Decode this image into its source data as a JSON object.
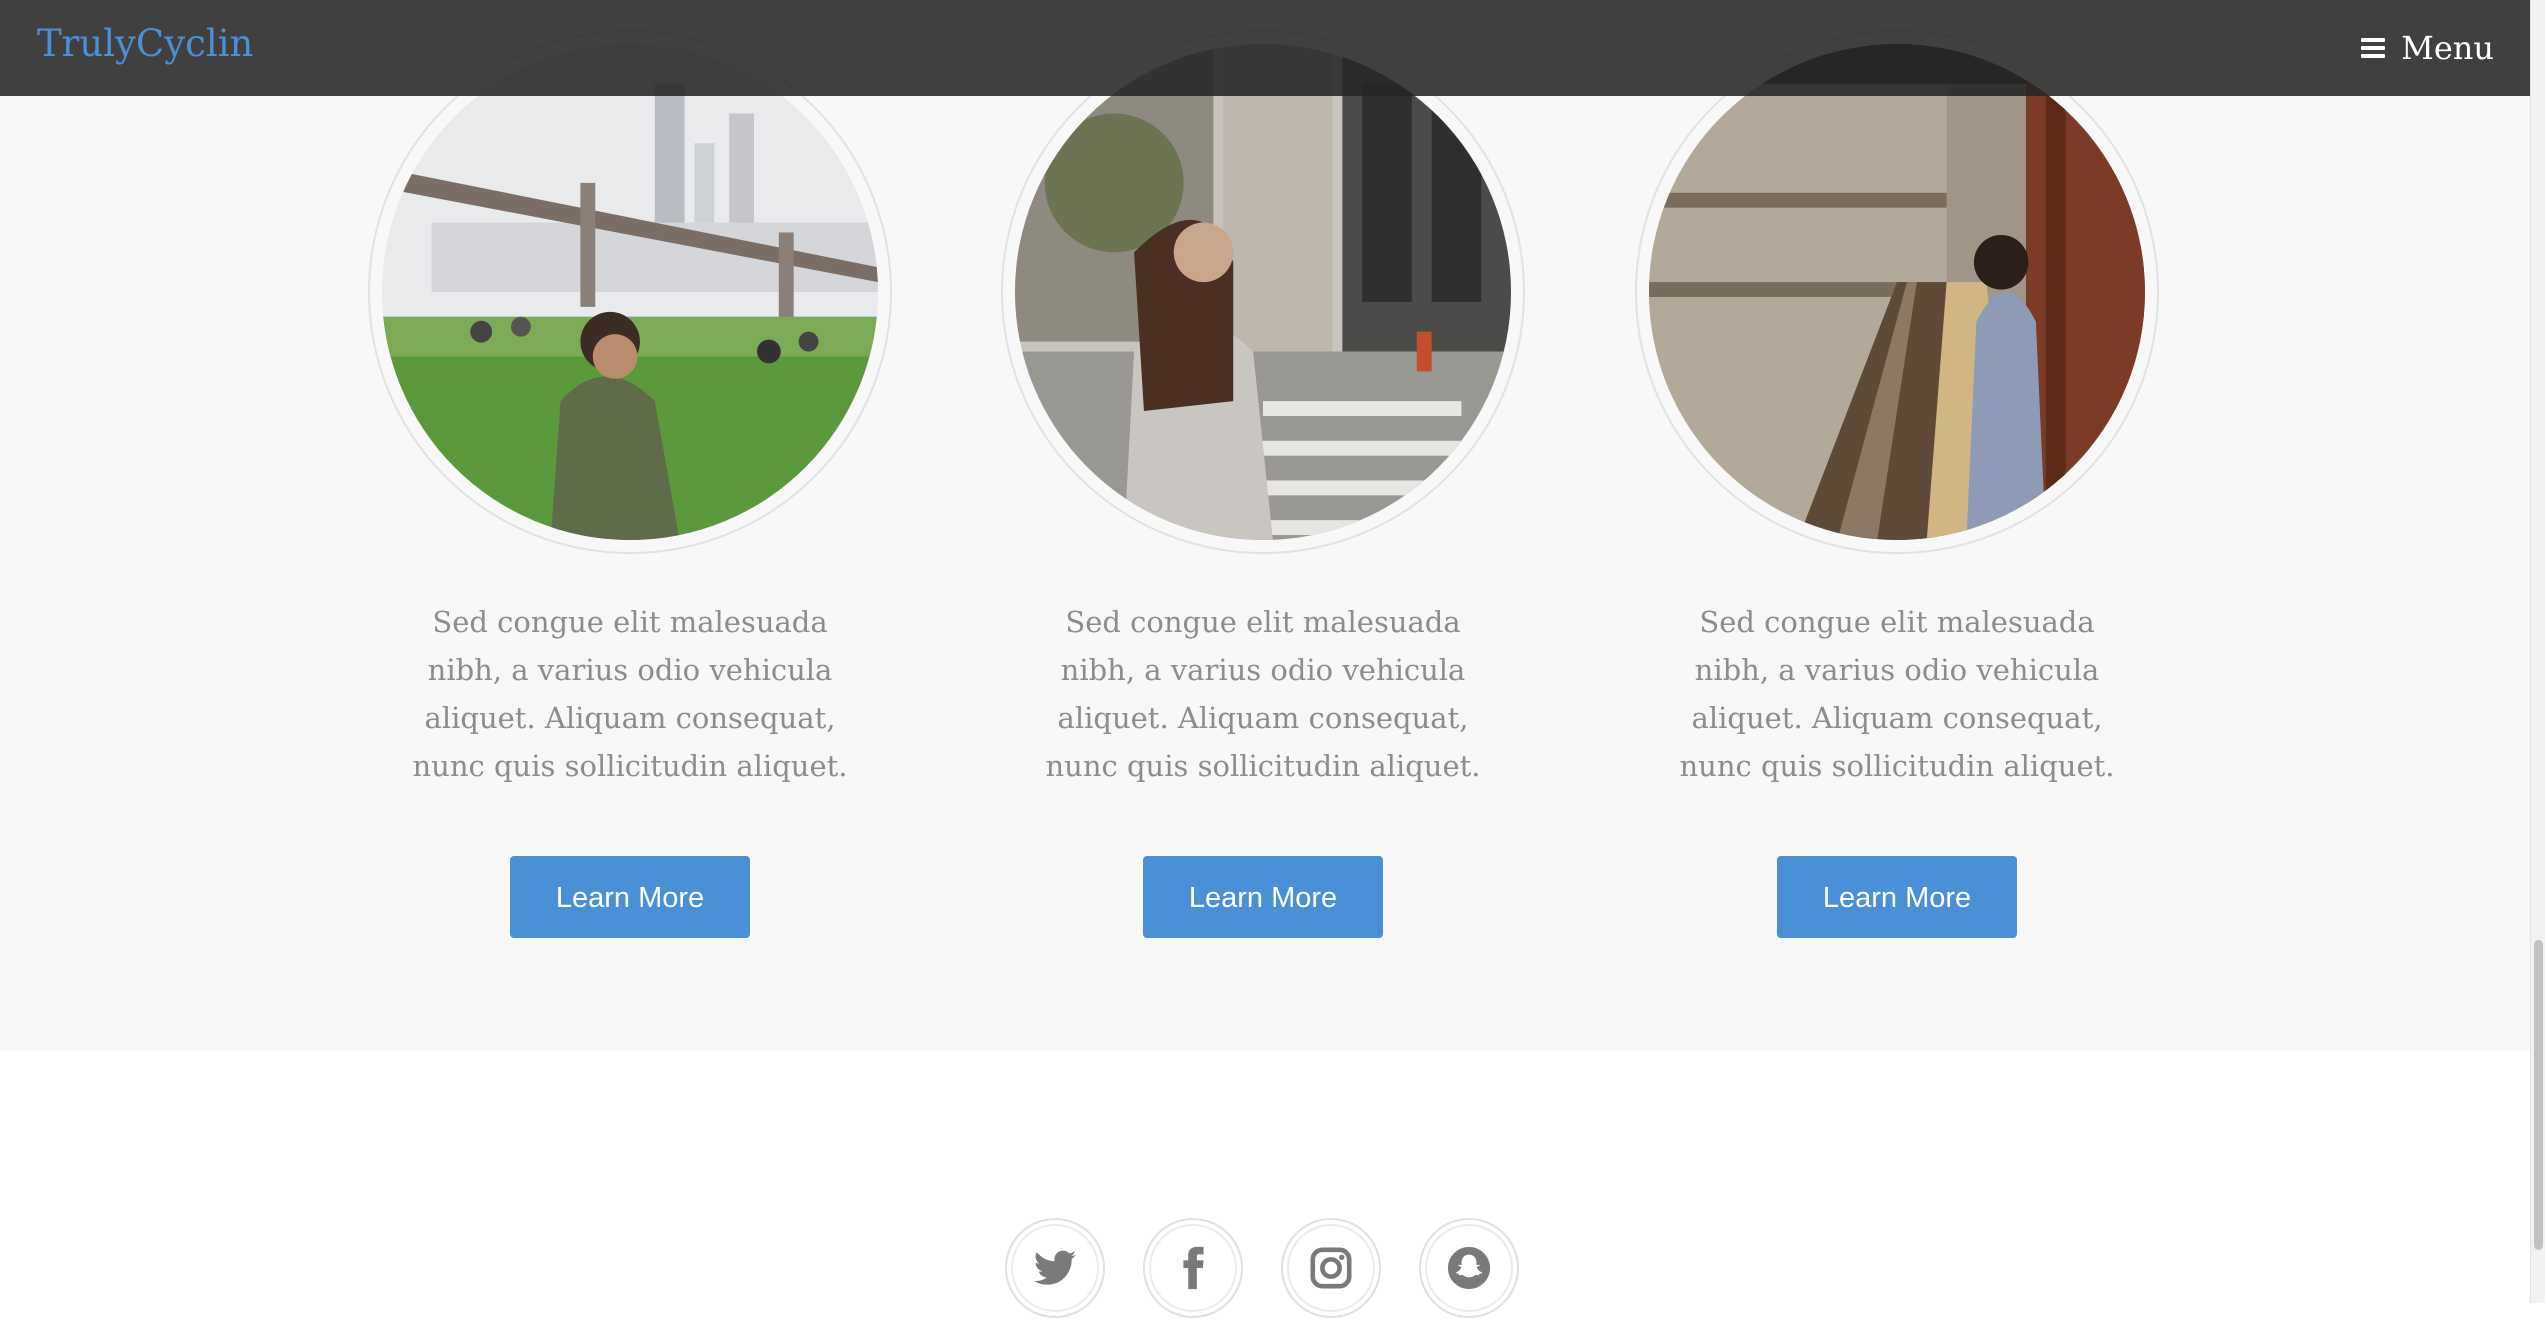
{
  "navbar": {
    "brand": "TrulyCyclin",
    "menu_label": "Menu",
    "menu_icon": "hamburger-icon"
  },
  "features": {
    "cards": [
      {
        "image": "man-sitting-on-grass-near-bridge",
        "text": "Sed congue elit malesuada nibh, a varius odio vehicula aliquet. Aliquam consequat, nunc quis sollicitudin aliquet.",
        "button_label": "Learn More"
      },
      {
        "image": "woman-at-crosswalk",
        "text": "Sed congue elit malesuada nibh, a varius odio vehicula aliquet. Aliquam consequat, nunc quis sollicitudin aliquet.",
        "button_label": "Learn More"
      },
      {
        "image": "man-in-subway-station",
        "text": "Sed congue elit malesuada nibh, a varius odio vehicula aliquet. Aliquam consequat, nunc quis sollicitudin aliquet.",
        "button_label": "Learn More"
      }
    ]
  },
  "footer": {
    "socials": [
      "twitter-icon",
      "facebook-icon",
      "instagram-icon",
      "snapchat-icon"
    ]
  },
  "colors": {
    "accent": "#4a90d6",
    "navbar": "#262626",
    "section_bg": "#f8f8f8",
    "body_text": "#8d8d8d"
  }
}
